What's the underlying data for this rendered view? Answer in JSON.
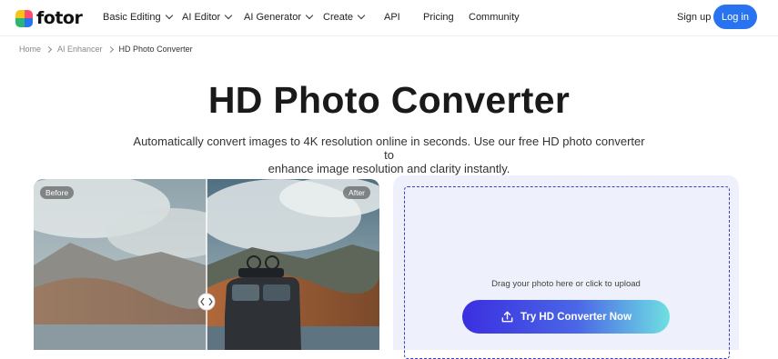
{
  "brand": {
    "name": "fotor",
    "colors": [
      "#f5c518",
      "#ff4d6d",
      "#2bb673",
      "#2a73f0"
    ]
  },
  "nav": {
    "items": [
      {
        "label": "Basic Editing",
        "dropdown": true
      },
      {
        "label": "AI Editor",
        "dropdown": true
      },
      {
        "label": "AI Generator",
        "dropdown": true
      },
      {
        "label": "Create",
        "dropdown": true
      },
      {
        "label": "API",
        "dropdown": false
      },
      {
        "label": "Pricing",
        "dropdown": false
      },
      {
        "label": "Community",
        "dropdown": false
      }
    ],
    "signup": "Sign up",
    "login": "Log in",
    "accent": "#2a73f0"
  },
  "breadcrumb": [
    "Home",
    "AI Enhancer",
    "HD Photo Converter"
  ],
  "hero": {
    "title": "HD Photo Converter",
    "subtitle_line1": "Automatically convert images to 4K resolution online in seconds. Use our free HD photo converter to",
    "subtitle_line2": "enhance image resolution and clarity instantly."
  },
  "compare": {
    "before_label": "Before",
    "after_label": "After",
    "handle_icon": "compare-arrows-icon"
  },
  "upload": {
    "hint": "Drag your photo here or click to upload",
    "button": "Try HD Converter Now",
    "button_icon": "upload-icon"
  }
}
